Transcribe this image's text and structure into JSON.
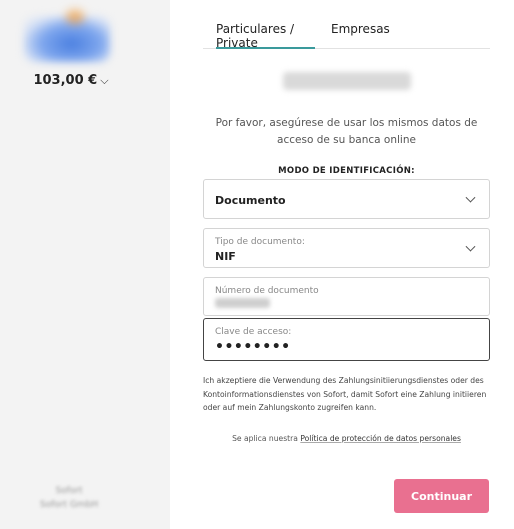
{
  "sidebar": {
    "amount": "103,00 €",
    "footer_line1": "Sofort",
    "footer_line2": "Sofort GmbH"
  },
  "tabs": [
    {
      "label": "Particulares / Private",
      "active": true
    },
    {
      "label": "Empresas",
      "active": false
    }
  ],
  "bank_name": "Bank",
  "info_text": "Por favor, asegúrese de usar los mismos datos de acceso de su banca online",
  "mode_title": "MODO DE IDENTIFICACIÓN:",
  "fields": {
    "mode": {
      "value": "Documento"
    },
    "doc_type": {
      "label": "Tipo de documento:",
      "value": "NIF"
    },
    "doc_number": {
      "label": "Número de documento"
    },
    "password": {
      "label": "Clave de acceso:",
      "value": "••••••••"
    }
  },
  "consent_text": "Ich akzeptiere die Verwendung des Zahlungsinitiierungsdienstes oder des Kontoinformationsdienstes von Sofort, damit Sofort eine Zahlung initiieren oder auf mein Zahlungskonto zugreifen kann.",
  "privacy": {
    "prefix": "Se aplica nuestra ",
    "link": "Política de protección de datos personales"
  },
  "submit_label": "Continuar",
  "colors": {
    "accent_tab": "#3a9a9c",
    "button": "#e97090"
  }
}
